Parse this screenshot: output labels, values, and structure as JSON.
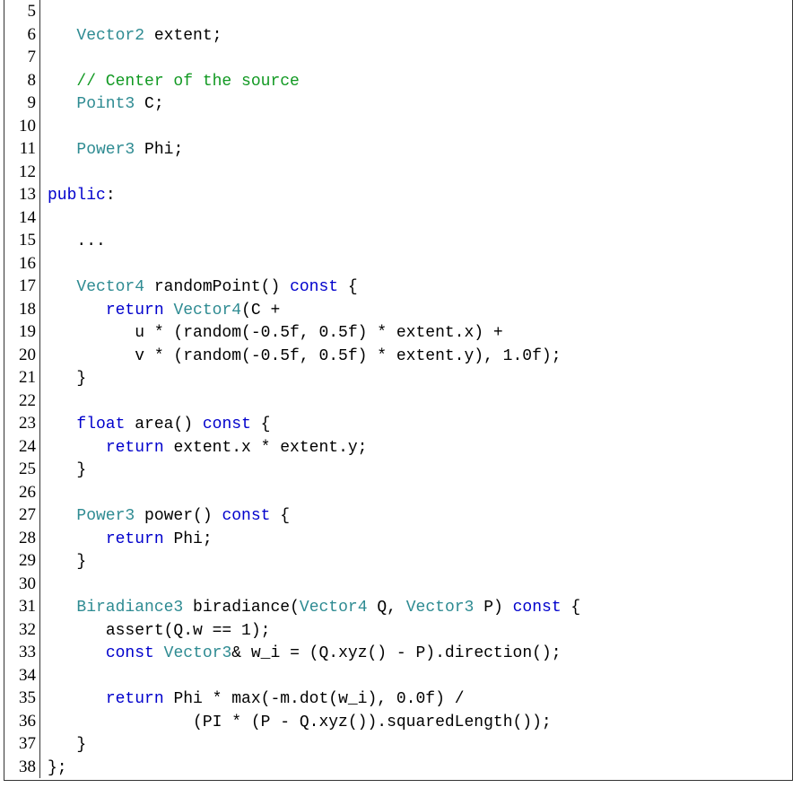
{
  "lines": {
    "5": {
      "num": "5",
      "tokens": []
    },
    "6": {
      "num": "6",
      "indent1": "   ",
      "t1": "Vector2",
      "s1": " ",
      "id1": "extent",
      "p1": ";"
    },
    "7": {
      "num": "7",
      "tokens": []
    },
    "8": {
      "num": "8",
      "indent1": "   ",
      "c1": "// Center of the source"
    },
    "9": {
      "num": "9",
      "indent1": "   ",
      "t1": "Point3",
      "s1": " ",
      "id1": "C",
      "p1": ";"
    },
    "10": {
      "num": "10",
      "tokens": []
    },
    "11": {
      "num": "11",
      "indent1": "   ",
      "t1": "Power3",
      "s1": " ",
      "id1": "Phi",
      "p1": ";"
    },
    "12": {
      "num": "12",
      "tokens": []
    },
    "13": {
      "num": "13",
      "kw1": "public",
      "p1": ":"
    },
    "14": {
      "num": "14",
      "tokens": []
    },
    "15": {
      "num": "15",
      "indent1": "   ",
      "id1": "..."
    },
    "16": {
      "num": "16",
      "tokens": []
    },
    "17": {
      "num": "17",
      "indent1": "   ",
      "t1": "Vector4",
      "s1": " ",
      "id1": "randomPoint",
      "p1": "() ",
      "kw1": "const",
      "p2": " {"
    },
    "18": {
      "num": "18",
      "indent1": "      ",
      "kw1": "return",
      "s1": " ",
      "t1": "Vector4",
      "p1": "(",
      "id1": "C +"
    },
    "19": {
      "num": "19",
      "indent1": "         ",
      "id1": "u * (random(-0.5f, 0.5f) * extent.x) +"
    },
    "20": {
      "num": "20",
      "indent1": "         ",
      "id1": "v * (random(-0.5f, 0.5f) * extent.y), 1.0f);"
    },
    "21": {
      "num": "21",
      "indent1": "   ",
      "p1": "}"
    },
    "22": {
      "num": "22",
      "tokens": []
    },
    "23": {
      "num": "23",
      "indent1": "   ",
      "kw1": "float",
      "s1": " ",
      "id1": "area",
      "p1": "() ",
      "kw2": "const",
      "p2": " {"
    },
    "24": {
      "num": "24",
      "indent1": "      ",
      "kw1": "return",
      "s1": " ",
      "id1": "extent.x * extent.y;"
    },
    "25": {
      "num": "25",
      "indent1": "   ",
      "p1": "}"
    },
    "26": {
      "num": "26",
      "tokens": []
    },
    "27": {
      "num": "27",
      "indent1": "   ",
      "t1": "Power3",
      "s1": " ",
      "id1": "power",
      "p1": "() ",
      "kw1": "const",
      "p2": " {"
    },
    "28": {
      "num": "28",
      "indent1": "      ",
      "kw1": "return",
      "s1": " ",
      "id1": "Phi;"
    },
    "29": {
      "num": "29",
      "indent1": "   ",
      "p1": "}"
    },
    "30": {
      "num": "30",
      "tokens": []
    },
    "31": {
      "num": "31",
      "indent1": "   ",
      "t1": "Biradiance3",
      "s1": " ",
      "id1": "biradiance",
      "p1": "(",
      "t2": "Vector4",
      "s2": " ",
      "id2": "Q",
      "p2": ", ",
      "t3": "Vector3",
      "s3": " ",
      "id3": "P",
      "p3": ") ",
      "kw1": "const",
      "p4": " {"
    },
    "32": {
      "num": "32",
      "indent1": "      ",
      "id1": "assert(Q.w == 1);"
    },
    "33": {
      "num": "33",
      "indent1": "      ",
      "kw1": "const",
      "s1": " ",
      "t1": "Vector3",
      "p1": "& ",
      "id1": "w_i = (Q.xyz() - P).direction();"
    },
    "34": {
      "num": "34",
      "tokens": []
    },
    "35": {
      "num": "35",
      "indent1": "      ",
      "kw1": "return",
      "s1": " ",
      "id1": "Phi * max(-m.dot(w_i), 0.0f) /"
    },
    "36": {
      "num": "36",
      "indent1": "               ",
      "id1": "(PI * (P - Q.xyz()).squaredLength());"
    },
    "37": {
      "num": "37",
      "indent1": "   ",
      "p1": "}"
    },
    "38": {
      "num": "38",
      "p1": "};"
    }
  }
}
